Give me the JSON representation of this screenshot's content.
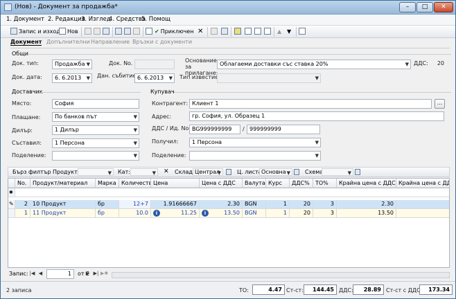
{
  "window": {
    "title": "(Нов) - Документ за продажба*",
    "minimize": "–",
    "maximize": "□",
    "close": "✕"
  },
  "menu": [
    "1. Документ",
    "2. Редакция",
    "3. Изглед",
    "4. Средства",
    "5. Помощ"
  ],
  "toolbar": {
    "save_close": "Запис и изход",
    "new": "Нов",
    "finish": "Приключен"
  },
  "tabs": [
    "Документ",
    "Допълнителни",
    "Направление",
    "Връзки с документи"
  ],
  "general": {
    "title": "Общи",
    "doc_type_label": "Док. тип:",
    "doc_type": "Продажба",
    "doc_no_label": "Док. No.",
    "doc_no": "",
    "doc_date_label": "Док. дата:",
    "doc_date": "6. 6.2013",
    "tax_date_label": "Дан. събитие:",
    "tax_date": "6. 6.2013",
    "basis_label": "Основание за прилагане:",
    "basis": "Облагаеми доставки със ставка 20%",
    "vat_label": "ДДС:",
    "vat": "20",
    "notice_label": "Тип известие:",
    "notice": ""
  },
  "supplier": {
    "title": "Доставчик",
    "place_label": "Място:",
    "place": "София",
    "payment_label": "Плащане:",
    "payment": "По банков път",
    "dealer_label": "Дилър:",
    "dealer": "1 Дилър",
    "compiled_label": "Съставил:",
    "compiled": "1 Персона",
    "division_label": "Поделение:",
    "division": ""
  },
  "buyer": {
    "title": "Купувач",
    "contractor_label": "Контрагент:",
    "contractor": "Клиент 1",
    "browse": "...",
    "address_label": "Адрес:",
    "address": "гр. София, ул. Образец 1",
    "vatid_label": "ДДС / Ид. No.",
    "vat_no": "BG999999999",
    "slash": "/",
    "id_no": "999999999",
    "received_label": "Получил:",
    "received": "1 Персона",
    "division_label": "Поделение:",
    "division": ""
  },
  "filter": {
    "quick": "Бърз филтър",
    "product": "Продукт:",
    "cat": "Кат:",
    "warehouse_label": "Склад",
    "warehouse": "Централ",
    "pricelist_label": "Ц. листа",
    "pricelist": "Основна",
    "scheme_label": "Схема",
    "scheme": ""
  },
  "grid": {
    "headers": [
      "No.",
      "Продукт/материал",
      "Марка",
      "Количество",
      "Цена",
      "Цена с ДДС",
      "Валута",
      "Курс",
      "ДДС%",
      "ТО%",
      "Крайна цена с ДДС",
      "Крайна цена с ДДС и"
    ],
    "new_row_marker": "✱",
    "edit_marker": "✎",
    "rows": [
      [
        "2",
        "10 Продукт",
        "бр",
        "12+7",
        "1.91666667",
        "2.30",
        "BGN",
        "1",
        "20",
        "3",
        "2.30",
        ""
      ],
      [
        "1",
        "11 Продукт",
        "бр",
        "10.0",
        "11.25",
        "13.50",
        "BGN",
        "1",
        "20",
        "3",
        "13.50",
        ""
      ]
    ]
  },
  "pager": {
    "label": "Запис:",
    "current": "1",
    "of": "от 2"
  },
  "status": {
    "records": "2 записа",
    "to_label": "ТО:",
    "to": "4.47",
    "st_label": "Ст-ст:",
    "st": "144.45",
    "vat_label": "ДДС:",
    "vat": "28.89",
    "stvat_label": "Ст-ст с ДДС:",
    "stvat": "173.34"
  }
}
